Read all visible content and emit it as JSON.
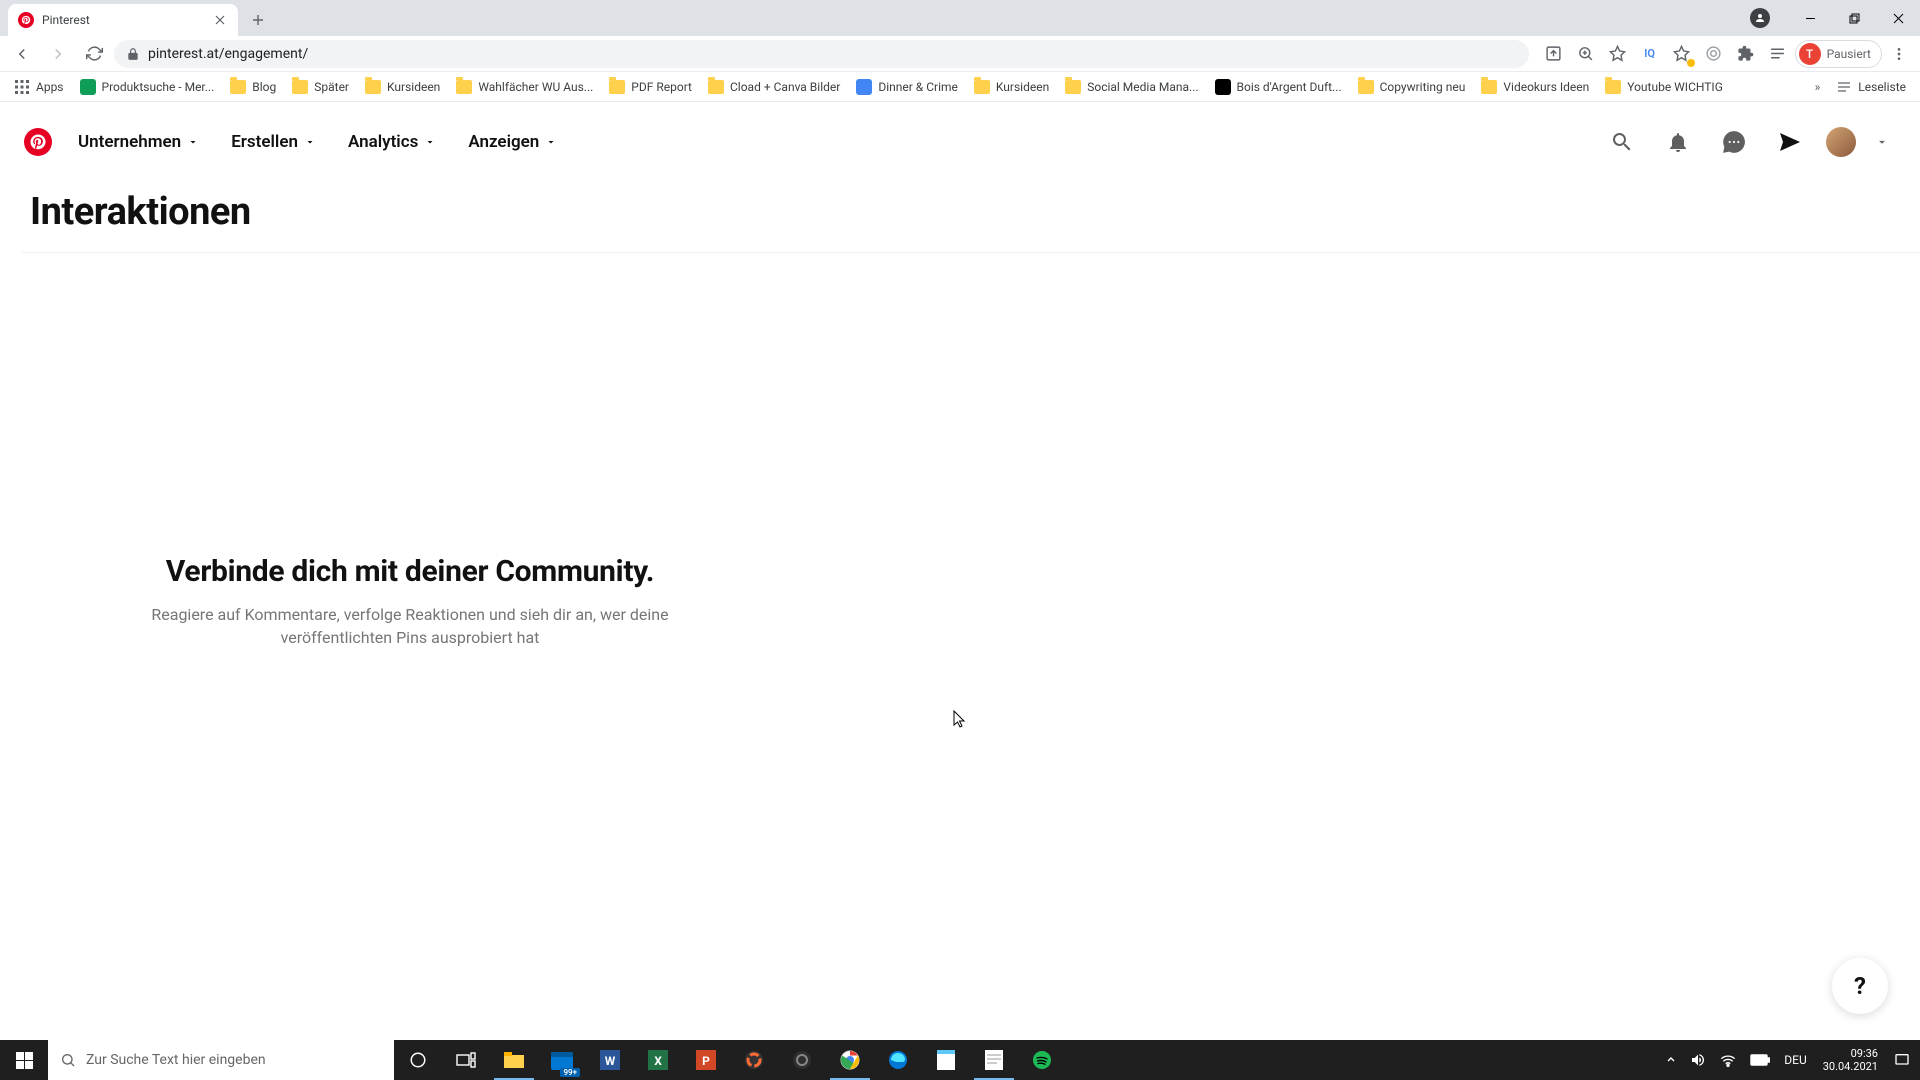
{
  "browser": {
    "tab_title": "Pinterest",
    "url": "pinterest.at/engagement/",
    "pausiert_label": "Pausiert",
    "pausiert_initial": "T"
  },
  "bookmarks": {
    "apps": "Apps",
    "items": [
      {
        "label": "Produktsuche - Mer...",
        "type": "sq",
        "color": "#0f9d58"
      },
      {
        "label": "Blog",
        "type": "folder"
      },
      {
        "label": "Später",
        "type": "folder"
      },
      {
        "label": "Kursideen",
        "type": "folder"
      },
      {
        "label": "Wahlfächer WU Aus...",
        "type": "folder"
      },
      {
        "label": "PDF Report",
        "type": "folder"
      },
      {
        "label": "Cload + Canva Bilder",
        "type": "folder"
      },
      {
        "label": "Dinner & Crime",
        "type": "sq",
        "color": "#4285f4"
      },
      {
        "label": "Kursideen",
        "type": "folder"
      },
      {
        "label": "Social Media Mana...",
        "type": "folder"
      },
      {
        "label": "Bois d'Argent Duft...",
        "type": "sq",
        "color": "#000"
      },
      {
        "label": "Copywriting neu",
        "type": "folder"
      },
      {
        "label": "Videokurs Ideen",
        "type": "folder"
      },
      {
        "label": "Youtube WICHTIG",
        "type": "folder"
      }
    ],
    "reading_list": "Leseliste"
  },
  "pinterest": {
    "nav": {
      "unternehmen": "Unternehmen",
      "erstellen": "Erstellen",
      "analytics": "Analytics",
      "anzeigen": "Anzeigen"
    },
    "page_title": "Interaktionen",
    "empty_title": "Verbinde dich mit deiner Community.",
    "empty_sub": "Reagiere auf Kommentare, verfolge Reaktionen und sieh dir an, wer deine veröffentlichten Pins ausprobiert hat",
    "help": "?"
  },
  "taskbar": {
    "search_placeholder": "Zur Suche Text hier eingeben",
    "calendar_badge": "99+",
    "lang": "DEU",
    "time": "09:36",
    "date": "30.04.2021"
  }
}
